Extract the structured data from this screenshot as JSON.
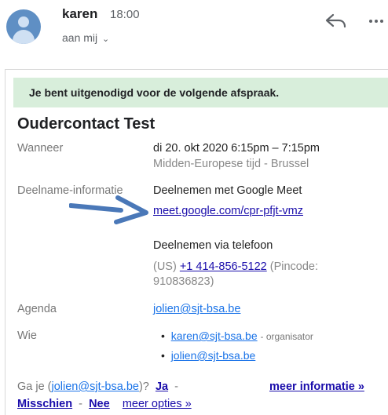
{
  "header": {
    "sender": "karen",
    "time": "18:00",
    "recipient": "aan mij",
    "chevron": "⌄",
    "reply_icon": "reply-icon",
    "more_icon": "more-horiz-icon"
  },
  "invite": {
    "banner": "Je bent uitgenodigd voor de volgende afspraak.",
    "title": "Oudercontact Test",
    "when_label": "Wanneer",
    "when_value": "di 20. okt 2020 6:15pm – 7:15pm",
    "timezone": "Midden-Europese tijd - Brussel",
    "join_label": "Deelname-informatie",
    "join_meet": "Deelnemen met Google Meet",
    "meet_link": "meet.google.com/cpr-pfjt-vmz",
    "join_phone": "Deelnemen via telefoon",
    "phone_country": "(US)",
    "phone_number": "+1 414-856-5122",
    "pin_text": "(Pincode:",
    "pin_value": "910836823)",
    "agenda_label": "Agenda",
    "agenda_value": "jolien@sjt-bsa.be",
    "who_label": "Wie",
    "guests": [
      {
        "email": "karen@sjt-bsa.be",
        "role": "- organisator"
      },
      {
        "email": "jolien@sjt-bsa.be",
        "role": ""
      }
    ]
  },
  "rsvp": {
    "question_prefix": "Ga je (",
    "question_email": "jolien@sjt-bsa.be",
    "question_suffix": ")?",
    "yes": "Ja",
    "sep1": "-",
    "maybe": "Misschien",
    "sep2": "-",
    "no": "Nee",
    "more_options": "meer opties »",
    "more_info": "meer informatie »"
  },
  "colors": {
    "banner_bg": "#d8eedb",
    "link": "#1a0dab",
    "arrow": "#4a78b8",
    "avatar": "#5f8fc4"
  }
}
